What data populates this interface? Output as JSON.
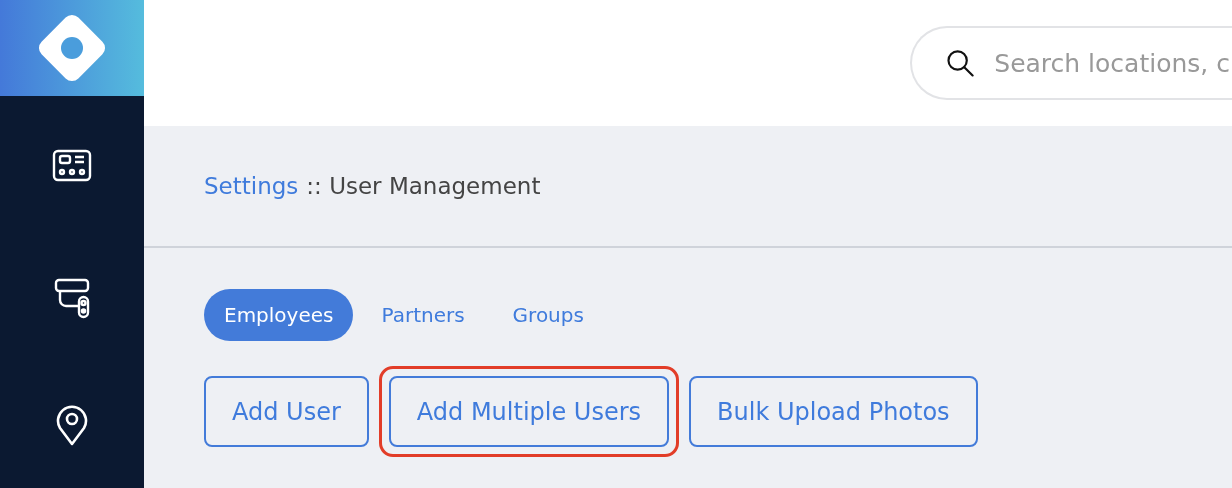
{
  "sidebar": {
    "items": [
      {
        "kind": "panel"
      },
      {
        "kind": "camera"
      },
      {
        "kind": "pin"
      }
    ]
  },
  "search": {
    "placeholder": "Search locations, c"
  },
  "breadcrumb": {
    "link": "Settings",
    "text": ":: User Management"
  },
  "tabs": [
    {
      "label": "Employees",
      "selected": true
    },
    {
      "label": "Partners",
      "selected": false
    },
    {
      "label": "Groups",
      "selected": false
    }
  ],
  "buttons": [
    {
      "label": "Add User",
      "highlighted": false
    },
    {
      "label": "Add Multiple Users",
      "highlighted": true
    },
    {
      "label": "Bulk Upload Photos",
      "highlighted": false
    }
  ]
}
